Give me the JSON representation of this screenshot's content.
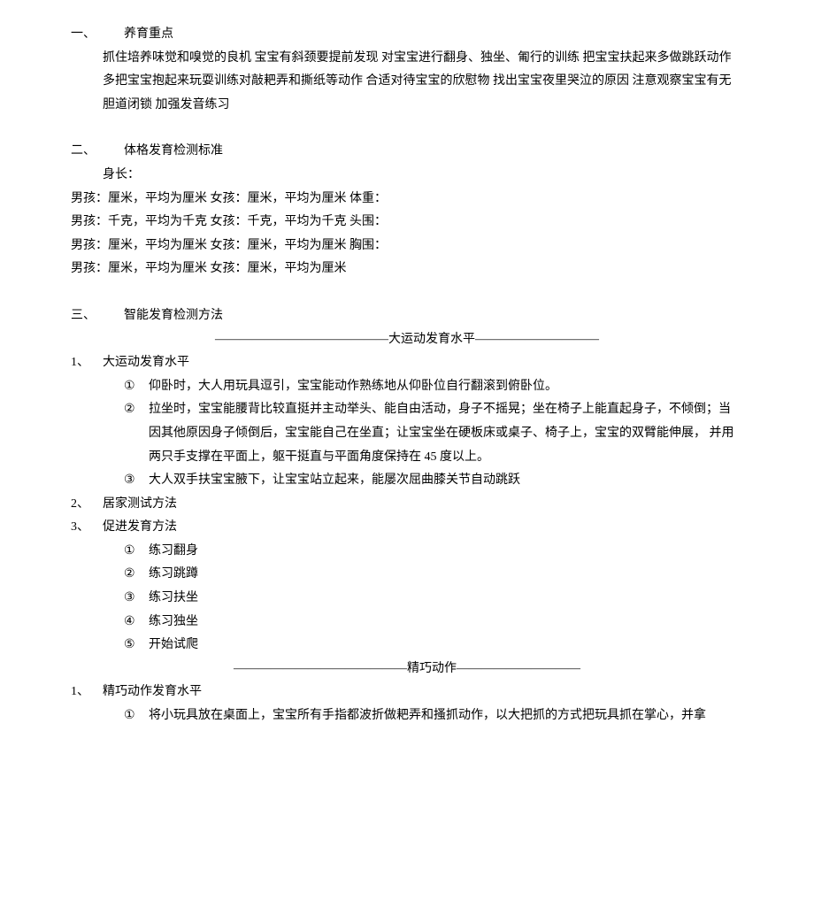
{
  "s1": {
    "num": "一、",
    "title": "养育重点",
    "body": "抓住培养味觉和嗅觉的良机 宝宝有斜颈要提前发现 对宝宝进行翻身、独坐、匍行的训练 把宝宝扶起来多做跳跃动作 多把宝宝抱起来玩耍训练对敲耙弄和撕纸等动作 合适对待宝宝的欣慰物 找出宝宝夜里哭泣的原因 注意观察宝宝有无胆道闭锁 加强发音练习"
  },
  "s2": {
    "num": "二、",
    "title": "体格发育检测标准",
    "sub": "身长：",
    "l1": "男孩：厘米，平均为厘米 女孩：厘米，平均为厘米 体重：",
    "l2": "男孩：千克，平均为千克 女孩：千克，平均为千克 头围：",
    "l3": "男孩：厘米，平均为厘米 女孩：厘米，平均为厘米 胸围：",
    "l4": "男孩：厘米，平均为厘米 女孩：厘米，平均为厘米"
  },
  "s3": {
    "num": "三、",
    "title": "智能发育检测方法",
    "div1": "——————————————大运动发育水平——————————",
    "g1": {
      "num": "1、",
      "title": "大运动发育水平"
    },
    "c1": {
      "mark": "①",
      "text": "仰卧时，大人用玩具逗引，宝宝能动作熟练地从仰卧位自行翻滚到俯卧位。"
    },
    "c2": {
      "mark": "②",
      "text": "拉坐时，宝宝能腰背比较直挺并主动举头、能自由活动，身子不摇晃；坐在椅子上能直起身子，不倾倒；当 因其他原因身子倾倒后，宝宝能自己在坐直；让宝宝坐在硬板床或桌子、椅子上，宝宝的双臂能伸展， 并用两只手支撑在平面上，躯干挺直与平面角度保持在 45 度以上。"
    },
    "c3": {
      "mark": "③",
      "text": "大人双手扶宝宝腋下，让宝宝站立起来，能屡次屈曲膝关节自动跳跃"
    },
    "g2": {
      "num": "2、",
      "title": "居家测试方法"
    },
    "g3": {
      "num": "3、",
      "title": "促进发育方法"
    },
    "p1": {
      "mark": "①",
      "text": "练习翻身"
    },
    "p2": {
      "mark": "②",
      "text": "练习跳蹲"
    },
    "p3": {
      "mark": "③",
      "text": "练习扶坐"
    },
    "p4": {
      "mark": "④",
      "text": "练习独坐"
    },
    "p5": {
      "mark": "⑤",
      "text": "开始试爬"
    },
    "div2": "——————————————精巧动作——————————",
    "g4": {
      "num": "1、",
      "title": "精巧动作发育水平"
    },
    "f1": {
      "mark": "①",
      "text": "将小玩具放在桌面上，宝宝所有手指都波折做耙弄和搔抓动作，以大把抓的方式把玩具抓在掌心，并拿"
    }
  }
}
